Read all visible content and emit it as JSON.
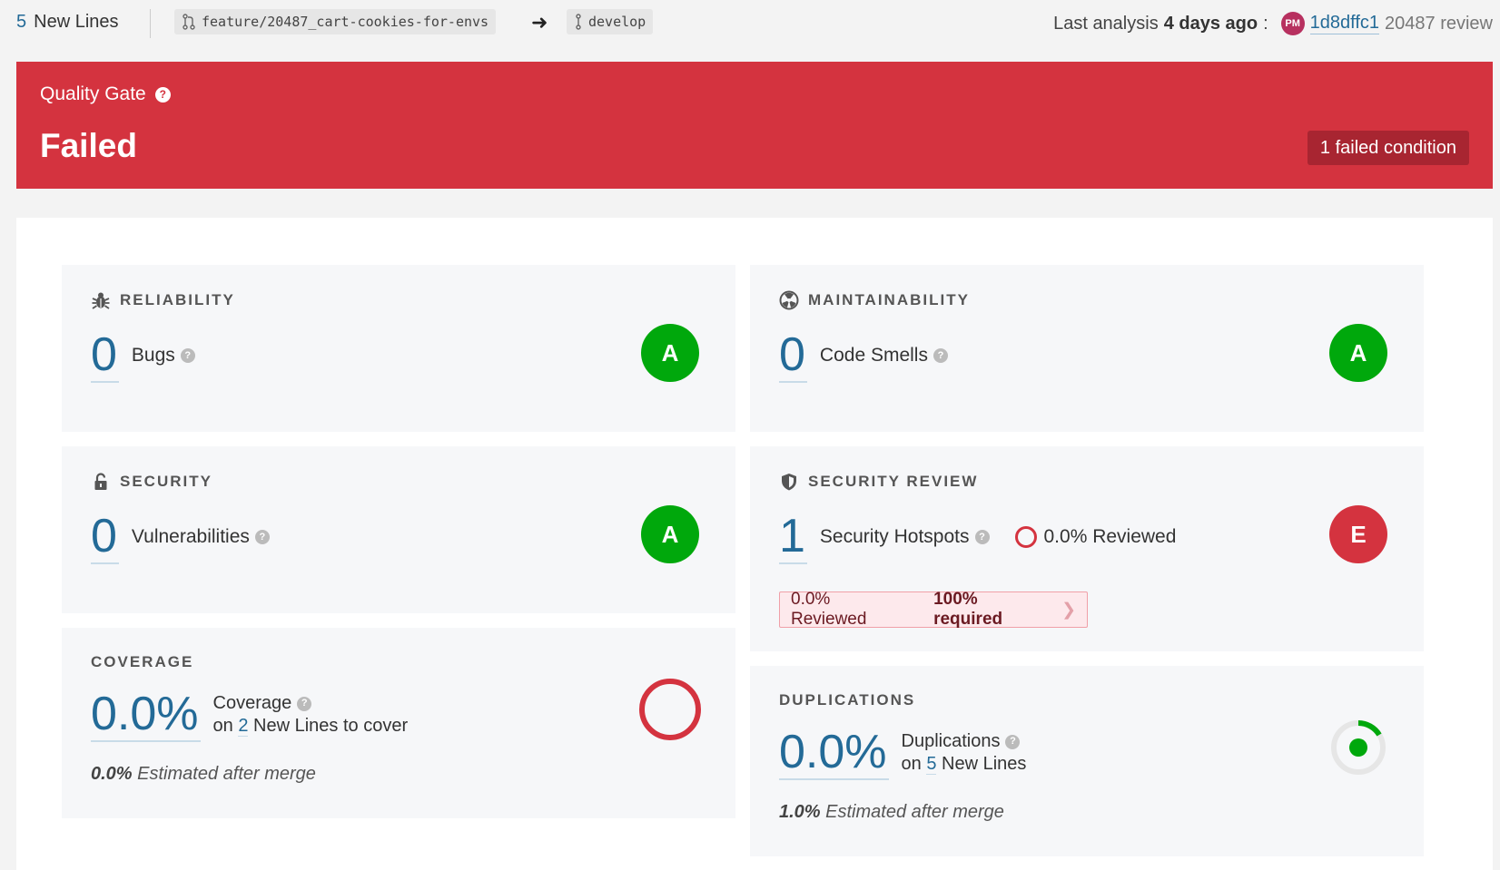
{
  "topbar": {
    "new_lines_count": "5",
    "new_lines_label": "New Lines",
    "source_branch": "feature/20487_cart-cookies-for-envs",
    "target_branch": "develop",
    "last_analysis_label": "Last analysis",
    "last_analysis_time": "4 days ago",
    "last_analysis_colon": ":",
    "avatar_initials": "PM",
    "commit": "1d8dffc1",
    "review": "20487 review"
  },
  "quality_gate": {
    "label": "Quality Gate",
    "help": "?",
    "status": "Failed",
    "failed_conditions": "1 failed condition",
    "color": "#d4333f"
  },
  "reliability": {
    "title": "RELIABILITY",
    "icon": "bug-icon",
    "value": "0",
    "label": "Bugs",
    "rating": "A"
  },
  "maintainability": {
    "title": "MAINTAINABILITY",
    "icon": "radiation-icon",
    "value": "0",
    "label": "Code Smells",
    "rating": "A"
  },
  "security": {
    "title": "SECURITY",
    "icon": "lock-icon",
    "value": "0",
    "label": "Vulnerabilities",
    "rating": "A"
  },
  "security_review": {
    "title": "SECURITY REVIEW",
    "icon": "shield-icon",
    "value": "1",
    "label": "Security Hotspots",
    "reviewed": "0.0% Reviewed",
    "rating": "E",
    "condition_reviewed": "0.0% Reviewed",
    "condition_required": "100% required"
  },
  "coverage": {
    "title": "COVERAGE",
    "value": "0.0%",
    "label": "Coverage",
    "on": "on",
    "new_lines_count": "2",
    "new_lines_text": "New Lines to cover",
    "estimate_value": "0.0%",
    "estimate_text": "Estimated after merge"
  },
  "duplications": {
    "title": "DUPLICATIONS",
    "value": "0.0%",
    "label": "Duplications",
    "on": "on",
    "new_lines_count": "5",
    "new_lines_text": "New Lines",
    "estimate_value": "1.0%",
    "estimate_text": "Estimated after merge"
  },
  "colors": {
    "link_blue": "#236a97",
    "rating_a": "#00a80c",
    "rating_e": "#d4333f",
    "card_bg": "#f6f7f9"
  }
}
